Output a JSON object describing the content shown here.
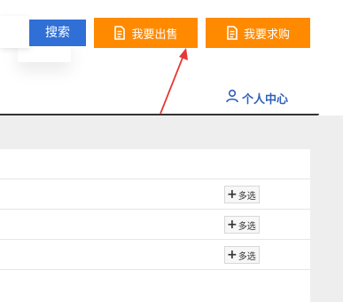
{
  "header": {
    "search": {
      "placeholder": "",
      "button_label": "搜索"
    },
    "actions": {
      "sell_label": "我要出售",
      "buy_label": "我要求购"
    },
    "user_center_label": "个人中心"
  },
  "table": {
    "rows": [
      {
        "action_label": "多选"
      },
      {
        "action_label": "多选"
      },
      {
        "action_label": "多选"
      }
    ]
  },
  "colors": {
    "search_button": "#2f6fd6",
    "action_buttons": "#ff8a00",
    "user_center": "#2f5fb8",
    "annotation_arrow": "#e53935"
  },
  "icons": {
    "action_button_icon": "document-icon",
    "user_center_icon": "user-icon",
    "row_action_icon": "plus-icon"
  }
}
